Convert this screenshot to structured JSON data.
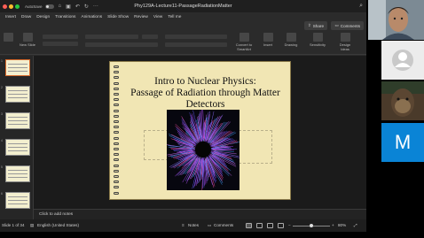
{
  "window": {
    "title": "Phy129A-Lecture11-PassageRadiationMatter",
    "autosave_label": "AutoSave"
  },
  "tabs": [
    "Insert",
    "Draw",
    "Design",
    "Transitions",
    "Animations",
    "Slide Show",
    "Review",
    "View",
    "Tell me"
  ],
  "actions": {
    "share": "Share",
    "comments": "Comments"
  },
  "ribbon": {
    "new_slide": "New Slide",
    "convert_to_smartart": "Convert to SmartArt",
    "insert": "Insert",
    "drawing": "Drawing",
    "sensitivity": "Sensitivity",
    "design_ideas": "Design Ideas"
  },
  "thumbnails": [
    {
      "num": "1",
      "selected": true
    },
    {
      "num": "2",
      "selected": false
    },
    {
      "num": "3",
      "selected": false
    },
    {
      "num": "4",
      "selected": false
    },
    {
      "num": "5",
      "selected": false
    },
    {
      "num": "6",
      "selected": false
    }
  ],
  "slide": {
    "title_lines": [
      "Intro to Nuclear Physics:",
      "Passage of Radiation through Matter",
      "Detectors"
    ]
  },
  "notes_placeholder": "Click to add notes",
  "status": {
    "slide_of": "Slide 1 of 34",
    "language": "English (United States)",
    "notes": "Notes",
    "comments": "Comments",
    "zoom": "80%",
    "zoom_fraction": 0.5
  },
  "participants": {
    "initial_tile": "M"
  },
  "colors": {
    "accent_orange": "#d6682a",
    "slide_bg": "#f1e6b4",
    "participant_blue": "#0a84d6"
  }
}
